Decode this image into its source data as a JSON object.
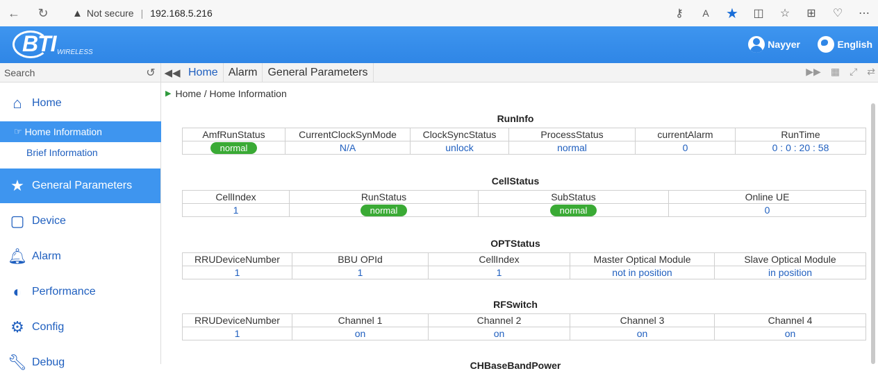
{
  "browser": {
    "security_label": "Not secure",
    "url": "192.168.5.216",
    "separator": "|"
  },
  "header": {
    "logo_text": "BTI",
    "logo_sub": "WIRELESS",
    "user": "Nayyer",
    "language": "English"
  },
  "sidebar": {
    "search_placeholder": "Search",
    "items": [
      {
        "label": "Home",
        "icon": "home-icon"
      },
      {
        "label": "General Parameters",
        "icon": "star-icon"
      },
      {
        "label": "Device",
        "icon": "tablet-icon"
      },
      {
        "label": "Alarm",
        "icon": "bell-icon"
      },
      {
        "label": "Performance",
        "icon": "half-circle-icon"
      },
      {
        "label": "Config",
        "icon": "gear-icon"
      },
      {
        "label": "Debug",
        "icon": "wrench-icon"
      }
    ],
    "sub_items": [
      "Home Information",
      "Brief Information"
    ]
  },
  "tabs": [
    "Home",
    "Alarm",
    "General Parameters"
  ],
  "breadcrumb": "Home / Home Information",
  "runinfo": {
    "title": "RunInfo",
    "headers": [
      "AmfRunStatus",
      "CurrentClockSynMode",
      "ClockSyncStatus",
      "ProcessStatus",
      "currentAlarm",
      "RunTime"
    ],
    "values": [
      "normal",
      "N/A",
      "unlock",
      "normal",
      "0",
      "0 : 0 : 20 : 58"
    ]
  },
  "cellstatus": {
    "title": "CellStatus",
    "headers": [
      "CellIndex",
      "RunStatus",
      "SubStatus",
      "Online UE"
    ],
    "values": [
      "1",
      "normal",
      "normal",
      "0"
    ]
  },
  "optstatus": {
    "title": "OPTStatus",
    "headers": [
      "RRUDeviceNumber",
      "BBU OPId",
      "CellIndex",
      "Master Optical Module",
      "Slave Optical Module"
    ],
    "values": [
      "1",
      "1",
      "1",
      "not in position",
      "in position"
    ]
  },
  "rfswitch": {
    "title": "RFSwitch",
    "headers": [
      "RRUDeviceNumber",
      "Channel 1",
      "Channel 2",
      "Channel 3",
      "Channel 4"
    ],
    "values": [
      "1",
      "on",
      "on",
      "on",
      "on"
    ]
  },
  "next_section_title": "CHBaseBandPower",
  "colors": {
    "accent": "#3e95ef",
    "link": "#1f5fbf",
    "ok": "#3aaa35"
  }
}
